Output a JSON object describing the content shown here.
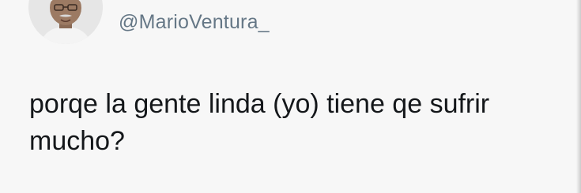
{
  "tweet": {
    "display_name": "",
    "handle": "@MarioVentura_",
    "text": "porqe la gente linda (yo) tiene qe sufrir mucho?"
  },
  "icons": {
    "avatar": "avatar-photo"
  }
}
